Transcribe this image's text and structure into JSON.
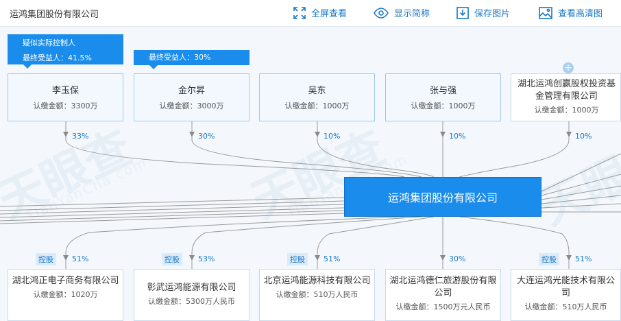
{
  "header": {
    "company_title": "运鸿集团股份有限公司",
    "fullscreen_label": "全屏查看",
    "show_abbr_label": "显示简称",
    "save_image_label": "保存图片",
    "view_hd_label": "查看高清图"
  },
  "watermark": {
    "brand": "天眼查",
    "domain": "TianYanCha.com"
  },
  "center": {
    "name": "运鸿集团股份有限公司"
  },
  "tags": {
    "suspected_controller": "疑似实际控制人",
    "ultimate_beneficiary_1": "最终受益人：41.5%",
    "ultimate_beneficiary_2": "最终受益人：30%"
  },
  "shareholders": [
    {
      "name": "李玉保",
      "capital": "认缴金额：3300万",
      "percent": "33%"
    },
    {
      "name": "金尔昇",
      "capital": "认缴金额：3000万",
      "percent": "30%"
    },
    {
      "name": "吴东",
      "capital": "认缴金额：1000万",
      "percent": "10%"
    },
    {
      "name": "张与强",
      "capital": "认缴金额：1000万",
      "percent": "10%"
    },
    {
      "name": "湖北运鸿创嬴股权投资基金管理有限公司",
      "capital": "认缴金额：1000万",
      "percent": "10%"
    }
  ],
  "subsidiaries": [
    {
      "name": "湖北鸿正电子商务有限公司",
      "capital": "认缴金额：1020万",
      "percent": "51%",
      "holding": "控股"
    },
    {
      "name": "彰武运鸿能源有限公司",
      "capital": "认缴金额：5300万人民币",
      "percent": "53%",
      "holding": "控股"
    },
    {
      "name": "北京运鸿能源科技有限公司",
      "capital": "认缴金额：510万人民币",
      "percent": "51%",
      "holding": "控股"
    },
    {
      "name": "湖北运鸿德仁旅游股份有限公司",
      "capital": "认缴金额：1500万元人民币",
      "percent": "30%",
      "holding": ""
    },
    {
      "name": "大连运鸿光能技术有限公司",
      "capital": "认缴金额：510万人民币",
      "percent": "51%",
      "holding": "控股"
    }
  ]
}
